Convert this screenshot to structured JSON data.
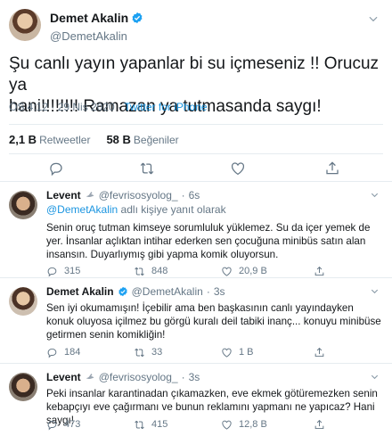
{
  "main": {
    "name": "Demet Akalin",
    "handle": "@DemetAkalin",
    "text": "Şu canlı yayın yapanlar bi su içmeseniz !! Orucuz ya\nhani!!!!!!!! Ramazan ya tutmasanda saygı!",
    "time": "ÖS 4:12 · 29 Nis 2020 · ",
    "source": "Twitter for iPhone",
    "retweets_count": "2,1 B",
    "retweets_label": "Retweetler",
    "likes_count": "58 B",
    "likes_label": "Beğeniler"
  },
  "replies": [
    {
      "name": "Levent",
      "handle": "@fevrisosyolog_",
      "time": "6s",
      "replying_mention": "@DemetAkalin",
      "replying_rest": " adlı kişiye yanıt olarak",
      "text": "Senin oruç tutman kimseye sorumluluk yüklemez. Su da içer yemek de yer. İnsanlar açlıktan intihar ederken sen çocuğuna minibüs satın alan insansın. Duyarlıymış gibi yapma komik oluyorsun.",
      "replies": "315",
      "retweets": "848",
      "likes": "20,9 B"
    },
    {
      "name": "Demet Akalin",
      "handle": "@DemetAkalin",
      "time": "3s",
      "text": "Sen iyi okumamışın! İçebilir ama ben başkasının canlı yayındayken konuk oluyosa içilmez bu görgü kuralı deil tabiki inanç... konuyu minibüse getirmen senin komikliğin!",
      "replies": "184",
      "retweets": "33",
      "likes": "1 B"
    },
    {
      "name": "Levent",
      "handle": "@fevrisosyolog_",
      "time": "3s",
      "text": "Peki insanlar karantinadan çıkamazken, eve ekmek götüremezken senin kebapçıyı eve çağırmanı ve bunun reklamını yapmanı ne yapıcaz? Hani saygı!",
      "replies": "473",
      "retweets": "415",
      "likes": "12,8 B"
    }
  ],
  "icons": {
    "reply": "reply-icon",
    "retweet": "retweet-icon",
    "like": "heart-icon",
    "share": "share-icon",
    "verified": "verified-badge-icon",
    "caret": "chevron-down-icon",
    "dove": "dove-icon"
  },
  "colors": {
    "accent": "#1b95e0",
    "verified": "#1da1f2",
    "muted": "#657786",
    "text": "#14171a"
  }
}
